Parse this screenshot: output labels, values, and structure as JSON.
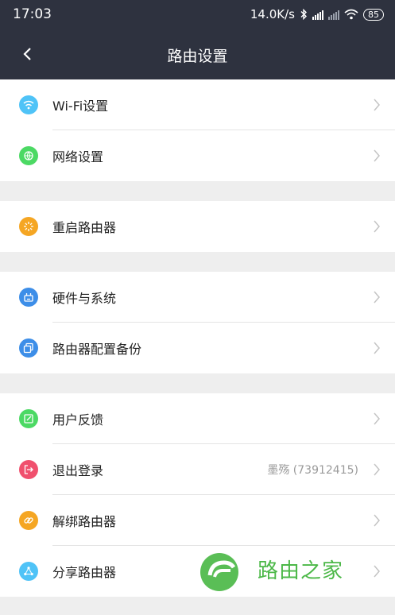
{
  "status_bar": {
    "time": "17:03",
    "net_speed": "14.0K/s",
    "battery": "85"
  },
  "header": {
    "title": "路由设置"
  },
  "groups": [
    {
      "items": [
        {
          "label": "Wi-Fi设置",
          "icon": "wifi-icon",
          "color": "#4fc3f7"
        },
        {
          "label": "网络设置",
          "icon": "globe-icon",
          "color": "#4cd964"
        }
      ]
    },
    {
      "items": [
        {
          "label": "重启路由器",
          "icon": "restart-icon",
          "color": "#f5a623"
        }
      ]
    },
    {
      "items": [
        {
          "label": "硬件与系统",
          "icon": "router-hardware-icon",
          "color": "#3d8ee8"
        },
        {
          "label": "路由器配置备份",
          "icon": "backup-copy-icon",
          "color": "#3d8ee8"
        }
      ]
    },
    {
      "items": [
        {
          "label": "用户反馈",
          "icon": "feedback-edit-icon",
          "color": "#4cd964"
        },
        {
          "label": "退出登录",
          "value": "墨殇 (73912415)",
          "icon": "logout-icon",
          "color": "#f0506e"
        },
        {
          "label": "解绑路由器",
          "icon": "unlink-icon",
          "color": "#f5a623"
        },
        {
          "label": "分享路由器",
          "icon": "share-icon",
          "color": "#4fc3f7"
        }
      ]
    }
  ],
  "watermark": {
    "text": "路由之家",
    "color": "#4cb848"
  }
}
